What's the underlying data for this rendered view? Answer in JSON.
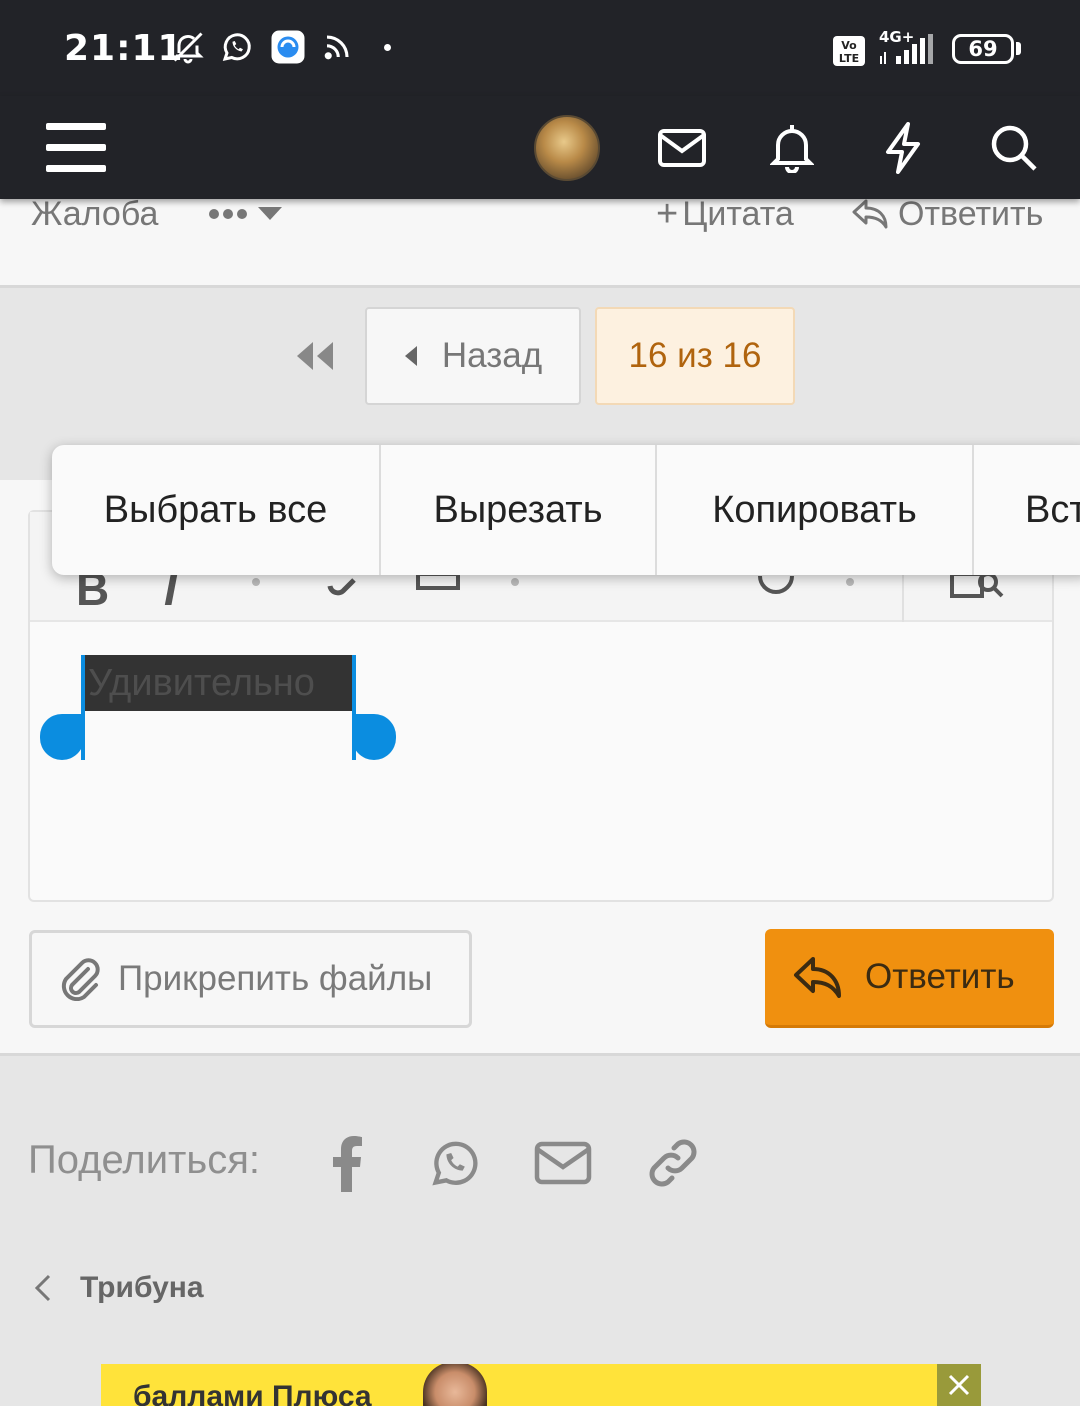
{
  "status_bar": {
    "time": "21:11",
    "network": "4G+",
    "volte": "Vo LTE",
    "battery": "69",
    "icons": [
      "mute-icon",
      "whatsapp-icon",
      "app-icon",
      "rss-icon",
      "signal-icon"
    ]
  },
  "header": {
    "icons": [
      "menu-icon",
      "avatar",
      "mail-icon",
      "bell-icon",
      "lightning-icon",
      "search-icon"
    ]
  },
  "post_actions": {
    "report": "Жалоба",
    "quote": "Цитата",
    "reply": "Ответить"
  },
  "pager": {
    "back": "Назад",
    "current": "16 из 16"
  },
  "context_menu": {
    "items": [
      "Выбрать все",
      "Вырезать",
      "Копировать",
      "Вст"
    ]
  },
  "editor": {
    "selected_text": "Удивительно"
  },
  "buttons": {
    "attach": "Прикрепить файлы",
    "reply": "Ответить"
  },
  "share": {
    "label": "Поделиться:",
    "icons": [
      "facebook-icon",
      "whatsapp-icon",
      "mail-icon",
      "link-icon"
    ]
  },
  "breadcrumb": {
    "label": "Трибуна"
  },
  "ad": {
    "text": "баллами Плюса"
  },
  "colors": {
    "header_bg": "#222328",
    "accent": "#f0900f",
    "current_page_text": "#b0640e",
    "selection_handle": "#0b8de0"
  }
}
